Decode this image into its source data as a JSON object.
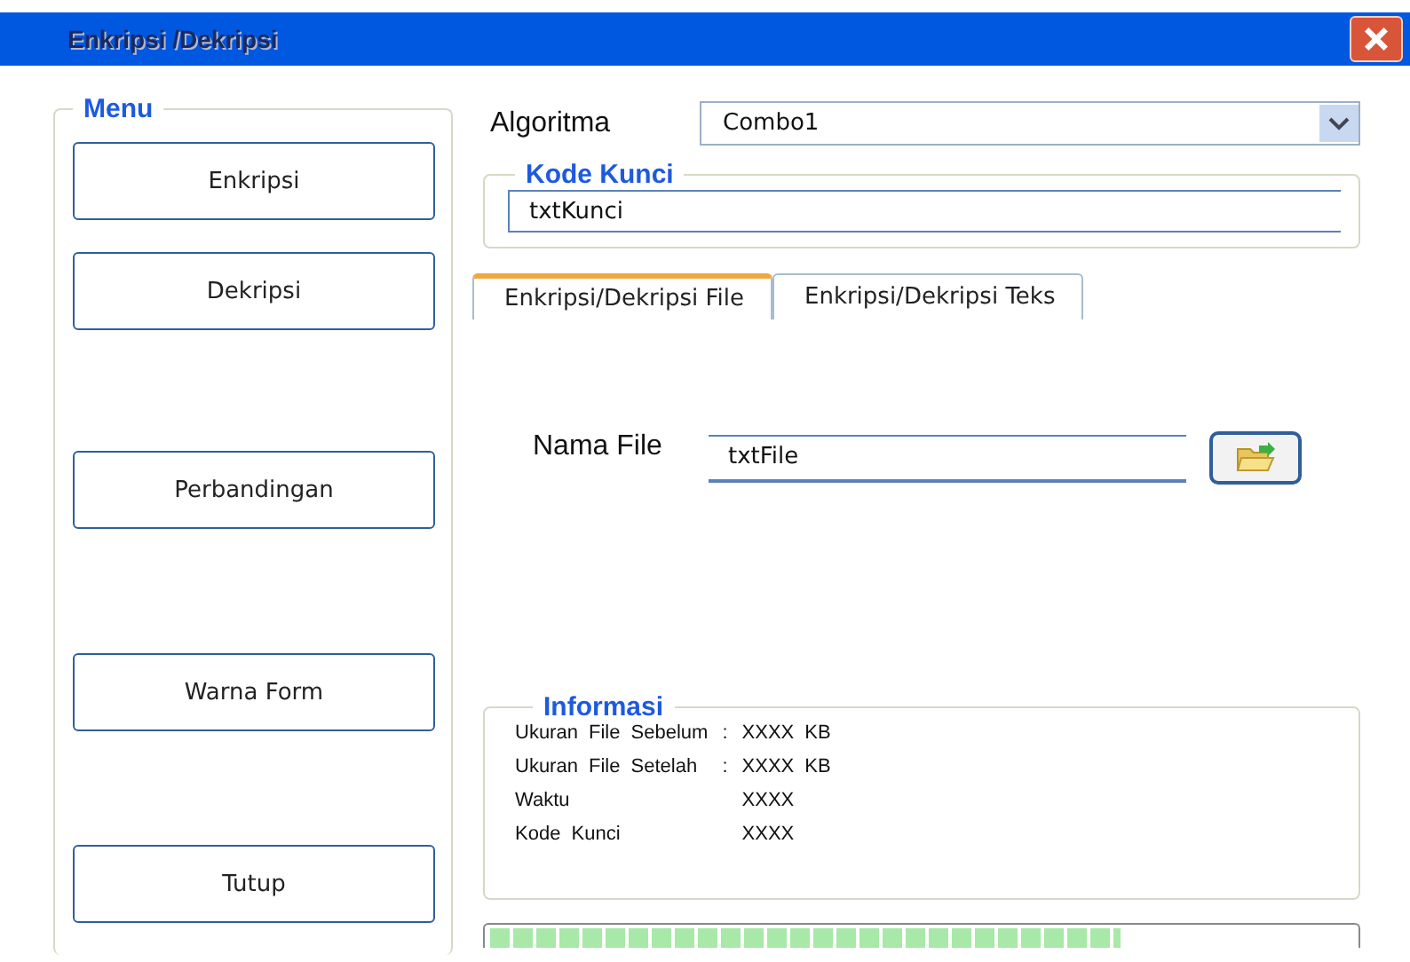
{
  "window": {
    "title": "Enkripsi /Dekripsi"
  },
  "menu": {
    "title": "Menu",
    "buttons": [
      "Enkripsi",
      "Dekripsi",
      "Perbandingan",
      "Warna Form",
      "Tutup"
    ]
  },
  "algoritma": {
    "label": "Algoritma",
    "value": "Combo1"
  },
  "kode_kunci": {
    "title": "Kode Kunci",
    "value": "txtKunci"
  },
  "tabs": [
    {
      "label": "Enkripsi/Dekripsi File",
      "selected": true
    },
    {
      "label": "Enkripsi/Dekripsi Teks",
      "selected": false
    }
  ],
  "nama_file": {
    "label": "Nama File",
    "value": "txtFile"
  },
  "informasi": {
    "title": "Informasi",
    "rows": [
      {
        "label": "Ukuran File Sebelum",
        "separator": ":",
        "value": "XXXX KB"
      },
      {
        "label": "Ukuran File Setelah",
        "separator": ":",
        "value": "XXXX KB"
      },
      {
        "label": "Waktu",
        "value": "XXXX"
      },
      {
        "label": "Kode Kunci",
        "value": "XXXX"
      }
    ]
  },
  "progress": {
    "level": 0.73
  }
}
